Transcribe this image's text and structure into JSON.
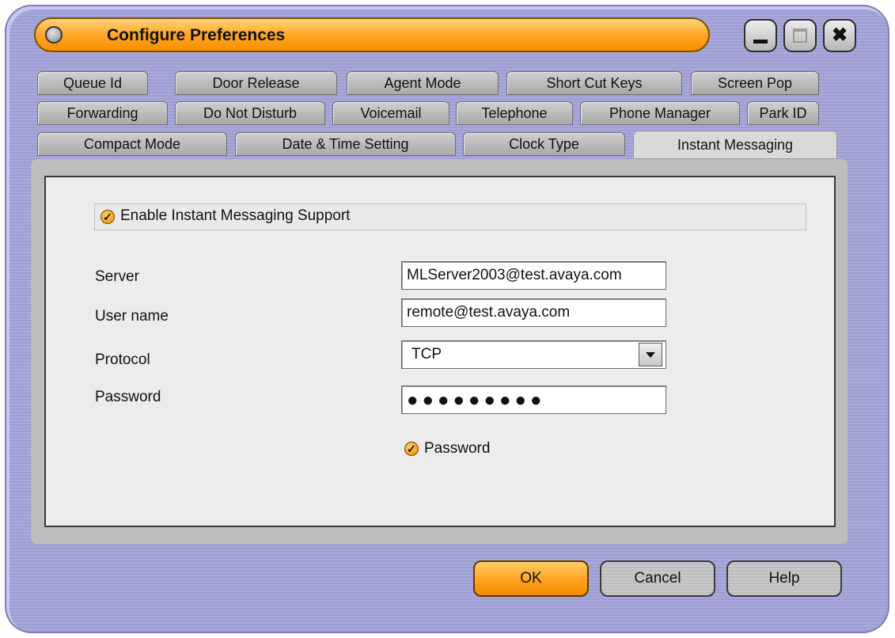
{
  "window": {
    "title": "Configure Preferences",
    "accent_color": "#ffa31f"
  },
  "tabs": {
    "row1": [
      "Queue Id",
      "Door Release",
      "Agent Mode",
      "Short Cut Keys",
      "Screen Pop"
    ],
    "row2": [
      "Forwarding",
      "Do Not Disturb",
      "Voicemail",
      "Telephone",
      "Phone Manager",
      "Park ID"
    ],
    "row3": [
      "Compact Mode",
      "Date & Time Setting",
      "Clock Type",
      "Instant Messaging"
    ],
    "active": "Instant Messaging"
  },
  "form": {
    "enable_label": "Enable Instant Messaging Support",
    "enable_checked": true,
    "server_label": "Server",
    "server_value": "MLServer2003@test.avaya.com",
    "username_label": "User name",
    "username_value": "remote@test.avaya.com",
    "protocol_label": "Protocol",
    "protocol_value": "TCP",
    "password_label": "Password",
    "password_value": "●●●●●●●●●",
    "save_password_label": "Password",
    "save_password_checked": true
  },
  "buttons": {
    "ok": "OK",
    "cancel": "Cancel",
    "help": "Help"
  }
}
